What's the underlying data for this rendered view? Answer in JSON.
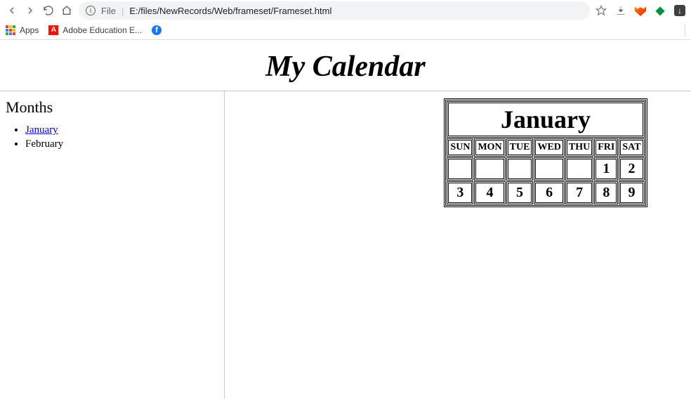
{
  "browser": {
    "file_label": "File",
    "url": "E:/files/NewRecords/Web/frameset/Frameset.html"
  },
  "bookmarks": {
    "apps": "Apps",
    "adobe": "Adobe Education E...",
    "facebook": ""
  },
  "page": {
    "title": "My Calendar"
  },
  "sidebar": {
    "heading": "Months",
    "items": [
      {
        "label": "January",
        "link": true
      },
      {
        "label": "February",
        "link": false
      }
    ]
  },
  "calendar": {
    "month": "January",
    "days_of_week": [
      "SUN",
      "MON",
      "TUE",
      "WED",
      "THU",
      "FRI",
      "SAT"
    ],
    "rows": [
      [
        "",
        "",
        "",
        "",
        "",
        "1",
        "2"
      ],
      [
        "3",
        "4",
        "5",
        "6",
        "7",
        "8",
        "9"
      ]
    ]
  }
}
